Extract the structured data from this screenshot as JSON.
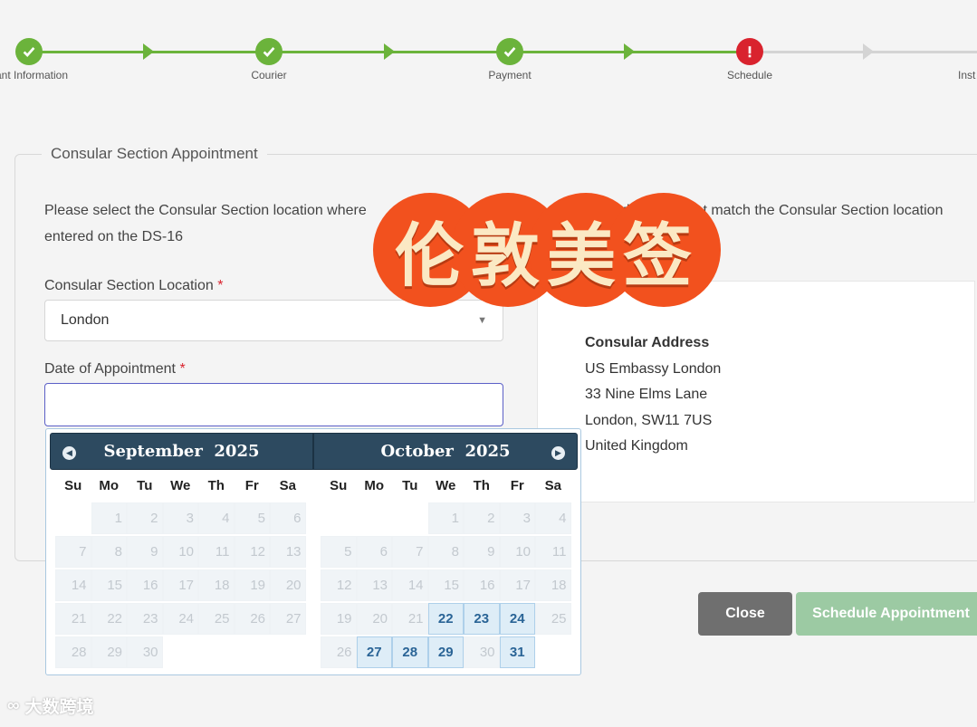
{
  "progress": {
    "steps": [
      {
        "label": "cant Information",
        "status": "done"
      },
      {
        "label": "Courier",
        "status": "done"
      },
      {
        "label": "Payment",
        "status": "done"
      },
      {
        "label": "Schedule",
        "status": "error"
      },
      {
        "label": "Inst",
        "status": "todo"
      }
    ]
  },
  "section": {
    "legend": "Consular Section Appointment",
    "intro": "Please select the Consular Section location where                                                 n selected below must match the Consular Section location entered on the DS-16"
  },
  "form": {
    "location_label": "Consular Section Location",
    "location_value": "London",
    "date_label": "Date of Appointment",
    "required_mark": "*"
  },
  "address": {
    "title": "Consular Address",
    "lines": [
      "US Embassy London",
      "33 Nine Elms Lane",
      "London, SW11 7US",
      "United Kingdom"
    ]
  },
  "buttons": {
    "close": "Close",
    "schedule": "Schedule Appointment"
  },
  "datepicker": {
    "left_title": "September  2025",
    "right_title": "October  2025",
    "days_of_week": [
      "Su",
      "Mo",
      "Tu",
      "We",
      "Th",
      "Fr",
      "Sa"
    ],
    "september": {
      "leading_blank": 1,
      "days": 30,
      "available": []
    },
    "october": {
      "leading_blank": 3,
      "days": 31,
      "available": [
        22,
        23,
        24,
        27,
        28,
        29,
        31
      ]
    }
  },
  "overlay": {
    "text": "伦敦美签"
  },
  "watermark": {
    "text": "大数跨境"
  }
}
